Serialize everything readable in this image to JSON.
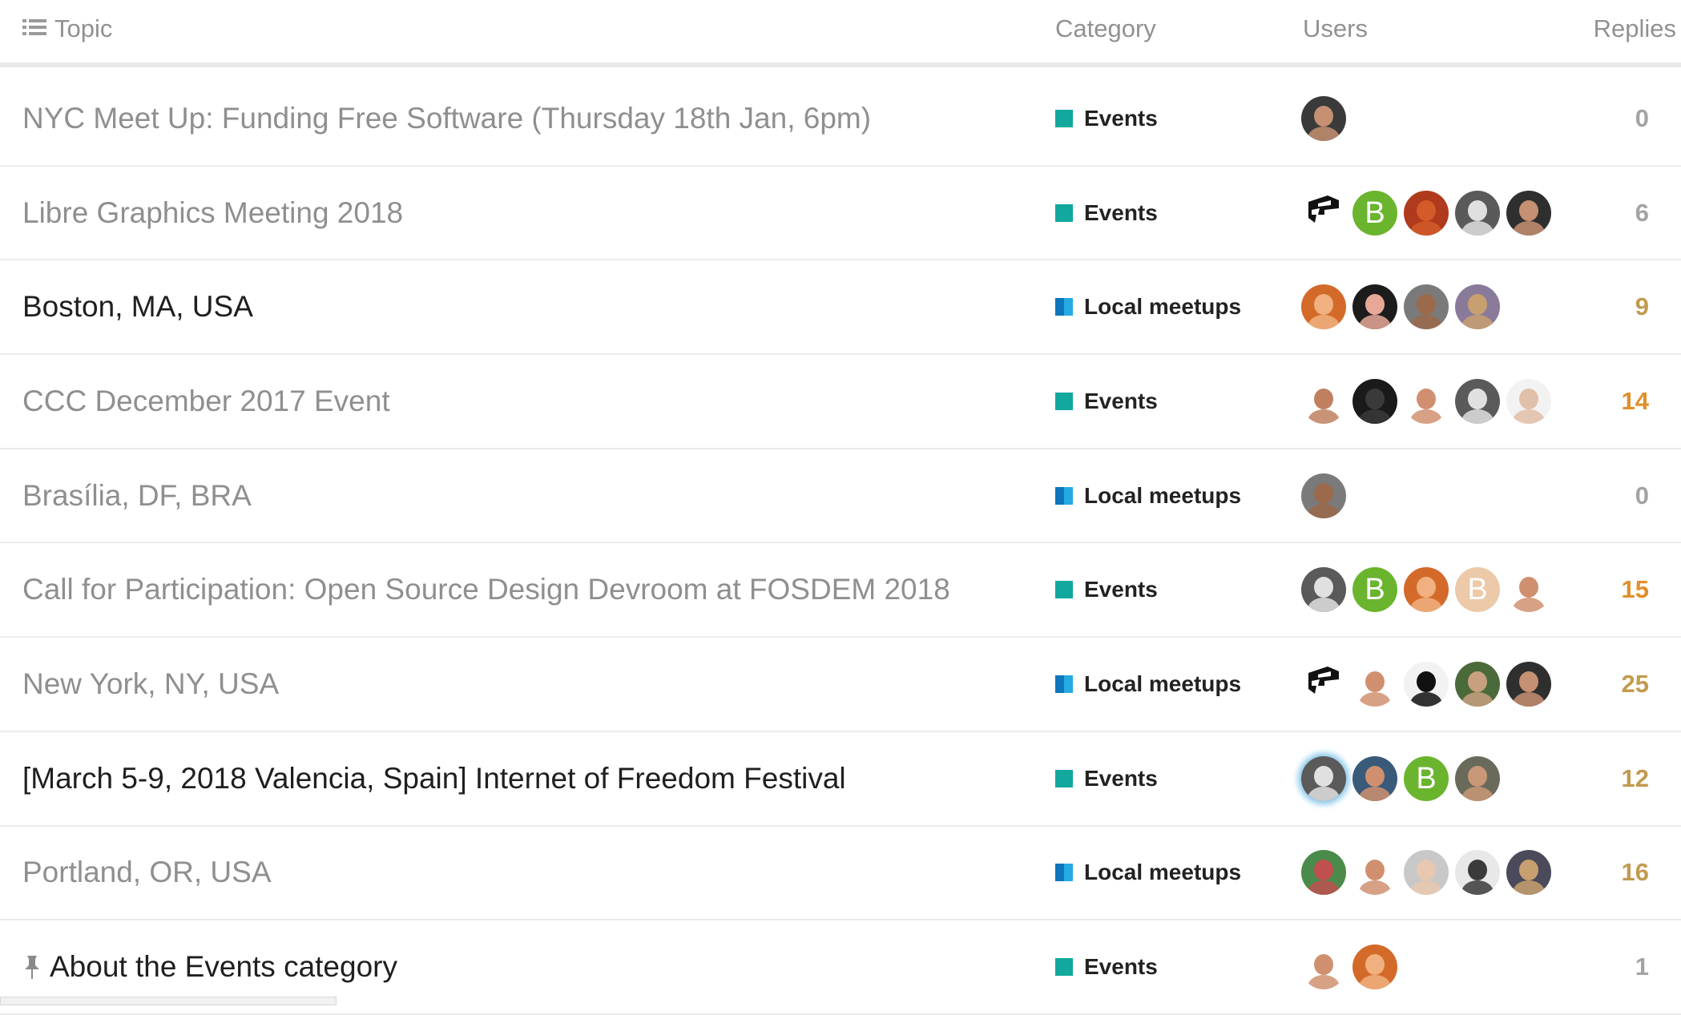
{
  "header": {
    "topic_label": "Topic",
    "category_label": "Category",
    "users_label": "Users",
    "replies_label": "Replies",
    "topic_icon": "list-icon"
  },
  "categories": {
    "Events": {
      "color": "#12a89d"
    },
    "Local meetups": {
      "color": "#0e76bd",
      "color2": "#25aae2"
    }
  },
  "topics": [
    {
      "title": "NYC Meet Up: Funding Free Software (Thursday 18th Jan, 6pm)",
      "unread": false,
      "pinned": false,
      "category": "Events",
      "replies": "0",
      "replies_color": "#a3a3a3",
      "users": [
        {
          "type": "photo",
          "bg": "#3a3a3a",
          "skin": "#c69072",
          "latest": false
        }
      ]
    },
    {
      "title": "Libre Graphics Meeting 2018",
      "unread": false,
      "pinned": false,
      "category": "Events",
      "replies": "6",
      "replies_color": "#a3a3a3",
      "users": [
        {
          "type": "logo",
          "bg": "#ffffff"
        },
        {
          "type": "letter",
          "letter": "B",
          "bg": "#6ab42e"
        },
        {
          "type": "photo",
          "bg": "#b03a1c",
          "skin": "#d45a2a"
        },
        {
          "type": "photo",
          "bg": "#5a5a5a",
          "skin": "#e0e0e0"
        },
        {
          "type": "photo",
          "bg": "#2f2f2f",
          "skin": "#c69072"
        }
      ]
    },
    {
      "title": "Boston, MA, USA",
      "unread": true,
      "pinned": false,
      "category": "Local meetups",
      "replies": "9",
      "replies_color": "#c29a4f",
      "users": [
        {
          "type": "photo",
          "bg": "#d46a2a",
          "skin": "#f0b080"
        },
        {
          "type": "photo",
          "bg": "#1c1c1c",
          "skin": "#e8a898"
        },
        {
          "type": "photo",
          "bg": "#7a7a7a",
          "skin": "#9a6a4a"
        },
        {
          "type": "photo",
          "bg": "#8a7a9a",
          "skin": "#c8a070"
        }
      ]
    },
    {
      "title": "CCC December 2017 Event",
      "unread": false,
      "pinned": false,
      "category": "Events",
      "replies": "14",
      "replies_color": "#e08f2a",
      "users": [
        {
          "type": "photo",
          "bg": "#ffffff",
          "skin": "#c08060"
        },
        {
          "type": "photo",
          "bg": "#1a1a1a",
          "skin": "#3a3a3a"
        },
        {
          "type": "photo",
          "bg": "#ffffff",
          "skin": "#d09070"
        },
        {
          "type": "photo",
          "bg": "#5a5a5a",
          "skin": "#e0e0e0"
        },
        {
          "type": "photo",
          "bg": "#f2f2f2",
          "skin": "#e0c0a8"
        }
      ]
    },
    {
      "title": "Brasília, DF, BRA",
      "unread": false,
      "pinned": false,
      "category": "Local meetups",
      "replies": "0",
      "replies_color": "#a3a3a3",
      "users": [
        {
          "type": "photo",
          "bg": "#7a7a7a",
          "skin": "#9a6a4a"
        }
      ]
    },
    {
      "title": "Call for Participation: Open Source Design Devroom at FOSDEM 2018",
      "unread": false,
      "pinned": false,
      "category": "Events",
      "replies": "15",
      "replies_color": "#e08f2a",
      "users": [
        {
          "type": "photo",
          "bg": "#5a5a5a",
          "skin": "#e0e0e0"
        },
        {
          "type": "letter",
          "letter": "B",
          "bg": "#6ab42e"
        },
        {
          "type": "photo",
          "bg": "#d46a2a",
          "skin": "#f0b080"
        },
        {
          "type": "letter",
          "letter": "B",
          "bg": "#ecc9a8"
        },
        {
          "type": "photo",
          "bg": "#ffffff",
          "skin": "#d09070"
        }
      ]
    },
    {
      "title": "New York, NY, USA",
      "unread": false,
      "pinned": false,
      "category": "Local meetups",
      "replies": "25",
      "replies_color": "#c29a4f",
      "users": [
        {
          "type": "logo",
          "bg": "#ffffff"
        },
        {
          "type": "photo",
          "bg": "#ffffff",
          "skin": "#d09070"
        },
        {
          "type": "photo",
          "bg": "#f2f2f2",
          "skin": "#111111"
        },
        {
          "type": "photo",
          "bg": "#4a6a3a",
          "skin": "#c8a080"
        },
        {
          "type": "photo",
          "bg": "#2f2f2f",
          "skin": "#c69072"
        }
      ]
    },
    {
      "title": "[March 5-9, 2018 Valencia, Spain] Internet of Freedom Festival",
      "unread": true,
      "pinned": false,
      "category": "Events",
      "replies": "12",
      "replies_color": "#c29a4f",
      "users": [
        {
          "type": "photo",
          "bg": "#5a5a5a",
          "skin": "#e0e0e0",
          "latest": true
        },
        {
          "type": "photo",
          "bg": "#3a5a7a",
          "skin": "#d09070"
        },
        {
          "type": "letter",
          "letter": "B",
          "bg": "#6ab42e"
        },
        {
          "type": "photo",
          "bg": "#6a6a5a",
          "skin": "#c89878"
        }
      ]
    },
    {
      "title": "Portland, OR, USA",
      "unread": false,
      "pinned": false,
      "category": "Local meetups",
      "replies": "16",
      "replies_color": "#c29a4f",
      "users": [
        {
          "type": "photo",
          "bg": "#4a8a4a",
          "skin": "#c05050"
        },
        {
          "type": "photo",
          "bg": "#ffffff",
          "skin": "#d09070"
        },
        {
          "type": "photo",
          "bg": "#c8c8c8",
          "skin": "#e8c8b0"
        },
        {
          "type": "photo",
          "bg": "#e8e8e8",
          "skin": "#3a3a3a"
        },
        {
          "type": "photo",
          "bg": "#4a4a5a",
          "skin": "#c8a070"
        }
      ]
    },
    {
      "title": "About the Events category",
      "unread": true,
      "pinned": true,
      "category": "Events",
      "replies": "1",
      "replies_color": "#a3a3a3",
      "users": [
        {
          "type": "photo",
          "bg": "#ffffff",
          "skin": "#d09070"
        },
        {
          "type": "photo",
          "bg": "#d46a2a",
          "skin": "#f0b080"
        }
      ]
    }
  ]
}
